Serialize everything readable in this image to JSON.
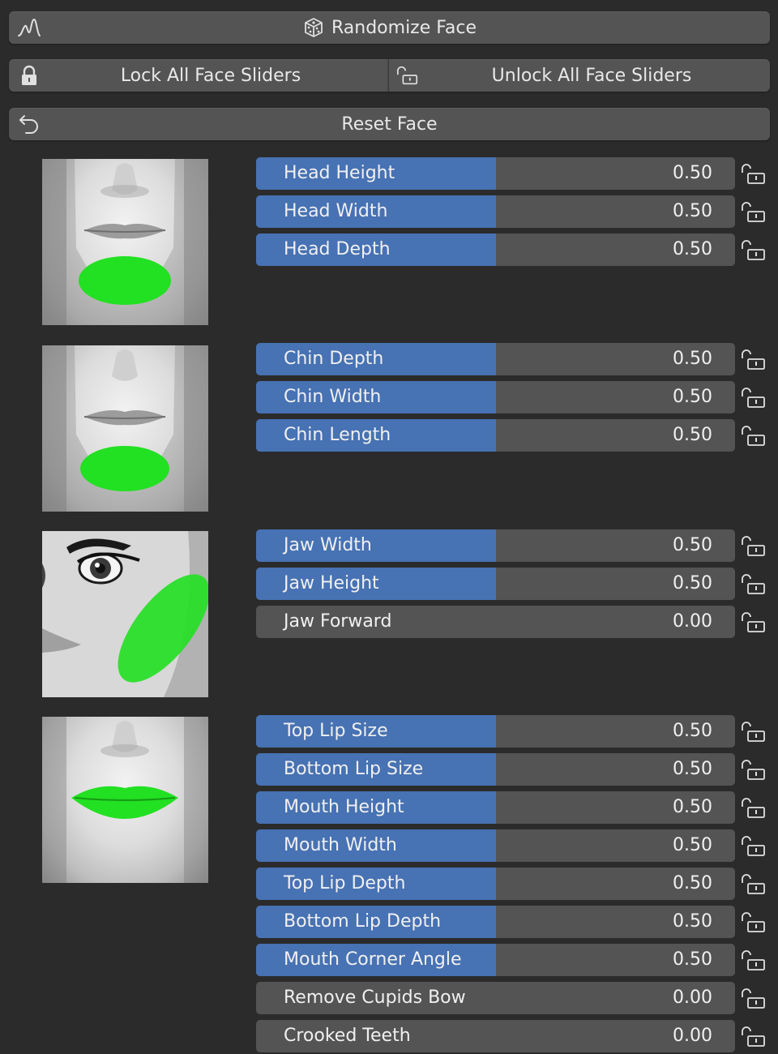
{
  "toolbar": {
    "randomize_label": "Randomize Face",
    "lock_all_label": "Lock All Face Sliders",
    "unlock_all_label": "Unlock All Face Sliders",
    "reset_label": "Reset Face"
  },
  "colors": {
    "panel_bg": "#2b2b2b",
    "button_bg": "#545454",
    "slider_fill": "#4772b3",
    "highlight_green": "#22e022"
  },
  "groups": [
    {
      "name": "head",
      "sliders": [
        {
          "label": "Head Height",
          "value": "0.50",
          "fraction": 0.5
        },
        {
          "label": "Head Width",
          "value": "0.50",
          "fraction": 0.5
        },
        {
          "label": "Head Depth",
          "value": "0.50",
          "fraction": 0.5
        }
      ]
    },
    {
      "name": "chin",
      "sliders": [
        {
          "label": "Chin Depth",
          "value": "0.50",
          "fraction": 0.5
        },
        {
          "label": "Chin Width",
          "value": "0.50",
          "fraction": 0.5
        },
        {
          "label": "Chin Length",
          "value": "0.50",
          "fraction": 0.5
        }
      ]
    },
    {
      "name": "jaw",
      "sliders": [
        {
          "label": "Jaw Width",
          "value": "0.50",
          "fraction": 0.5
        },
        {
          "label": "Jaw Height",
          "value": "0.50",
          "fraction": 0.5
        },
        {
          "label": "Jaw Forward",
          "value": "0.00",
          "fraction": 0.0
        }
      ]
    },
    {
      "name": "mouth",
      "sliders": [
        {
          "label": "Top Lip Size",
          "value": "0.50",
          "fraction": 0.5
        },
        {
          "label": "Bottom Lip Size",
          "value": "0.50",
          "fraction": 0.5
        },
        {
          "label": "Mouth Height",
          "value": "0.50",
          "fraction": 0.5
        },
        {
          "label": "Mouth Width",
          "value": "0.50",
          "fraction": 0.5
        },
        {
          "label": "Top Lip Depth",
          "value": "0.50",
          "fraction": 0.5
        },
        {
          "label": "Bottom Lip Depth",
          "value": "0.50",
          "fraction": 0.5
        },
        {
          "label": "Mouth Corner Angle",
          "value": "0.50",
          "fraction": 0.5
        },
        {
          "label": "Remove Cupids Bow",
          "value": "0.00",
          "fraction": 0.0
        },
        {
          "label": "Crooked Teeth",
          "value": "0.00",
          "fraction": 0.0
        }
      ]
    }
  ]
}
